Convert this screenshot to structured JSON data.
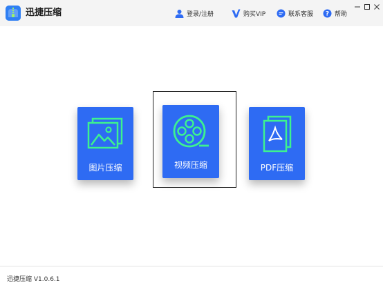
{
  "app": {
    "title": "迅捷压缩",
    "version_text": "迅捷压缩 V1.0.6.1",
    "accent_color": "#2e6bf3",
    "icon_accent_color": "#3df28f"
  },
  "toolbar": {
    "login_label": "登录/注册",
    "vip_label": "购买VIP",
    "service_label": "联系客服",
    "help_label": "帮助",
    "help_glyph": "?"
  },
  "icons": {
    "login": "user-icon",
    "vip": "vip-icon",
    "service": "chat-icon",
    "help": "help-icon",
    "image_card": "image-icon",
    "video_card": "film-reel-icon",
    "pdf_card": "pdf-file-icon"
  },
  "cards": [
    {
      "label": "图片压缩",
      "selected": false
    },
    {
      "label": "视频压缩",
      "selected": true
    },
    {
      "label": "PDF压缩",
      "selected": false
    }
  ]
}
